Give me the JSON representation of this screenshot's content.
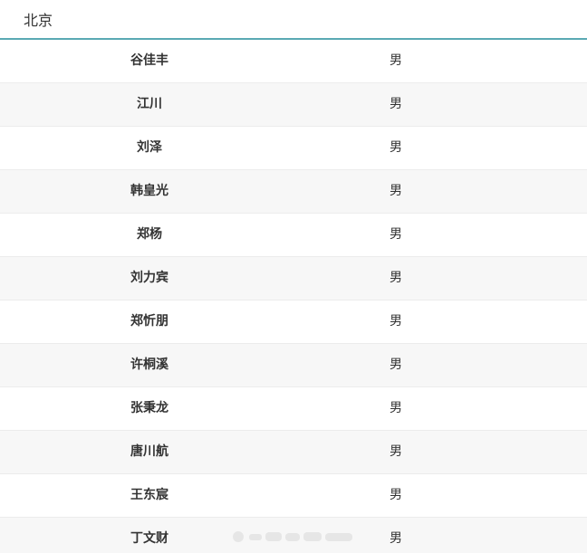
{
  "header": {
    "title": "北京"
  },
  "rows": [
    {
      "name": "谷佳丰",
      "gender": "男"
    },
    {
      "name": "江川",
      "gender": "男"
    },
    {
      "name": "刘泽",
      "gender": "男"
    },
    {
      "name": "韩皇光",
      "gender": "男"
    },
    {
      "name": "郑杨",
      "gender": "男"
    },
    {
      "name": "刘力宾",
      "gender": "男"
    },
    {
      "name": "郑忻朋",
      "gender": "男"
    },
    {
      "name": "许桐溪",
      "gender": "男"
    },
    {
      "name": "张秉龙",
      "gender": "男"
    },
    {
      "name": "唐川航",
      "gender": "男"
    },
    {
      "name": "王东宸",
      "gender": "男"
    },
    {
      "name": "丁文财",
      "gender": "男"
    }
  ],
  "colors": {
    "header_border": "#5aa9b3",
    "row_alt_bg": "#f7f7f7",
    "text": "#333333"
  }
}
